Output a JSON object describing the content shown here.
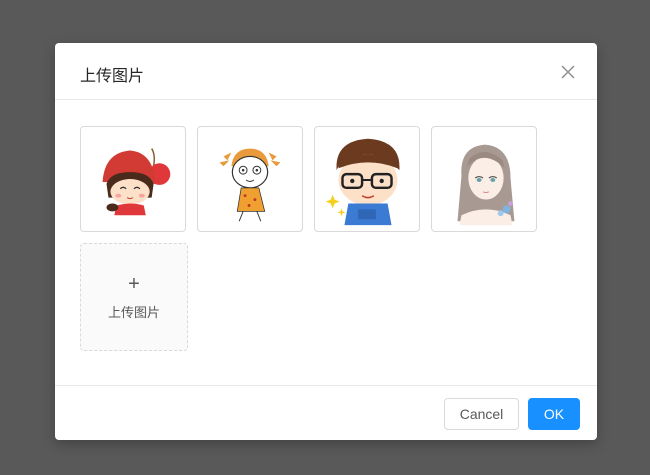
{
  "modal": {
    "title": "上传图片",
    "close_icon": "close-icon"
  },
  "images": [
    {
      "name": "cherry-girl-avatar"
    },
    {
      "name": "pigtail-girl-avatar"
    },
    {
      "name": "glasses-boy-avatar"
    },
    {
      "name": "long-hair-girl-avatar"
    }
  ],
  "upload": {
    "plus_symbol": "+",
    "label": "上传图片"
  },
  "footer": {
    "cancel_label": "Cancel",
    "ok_label": "OK"
  },
  "colors": {
    "overlay": "#595959",
    "primary": "#1890ff",
    "border": "#d9d9d9"
  }
}
